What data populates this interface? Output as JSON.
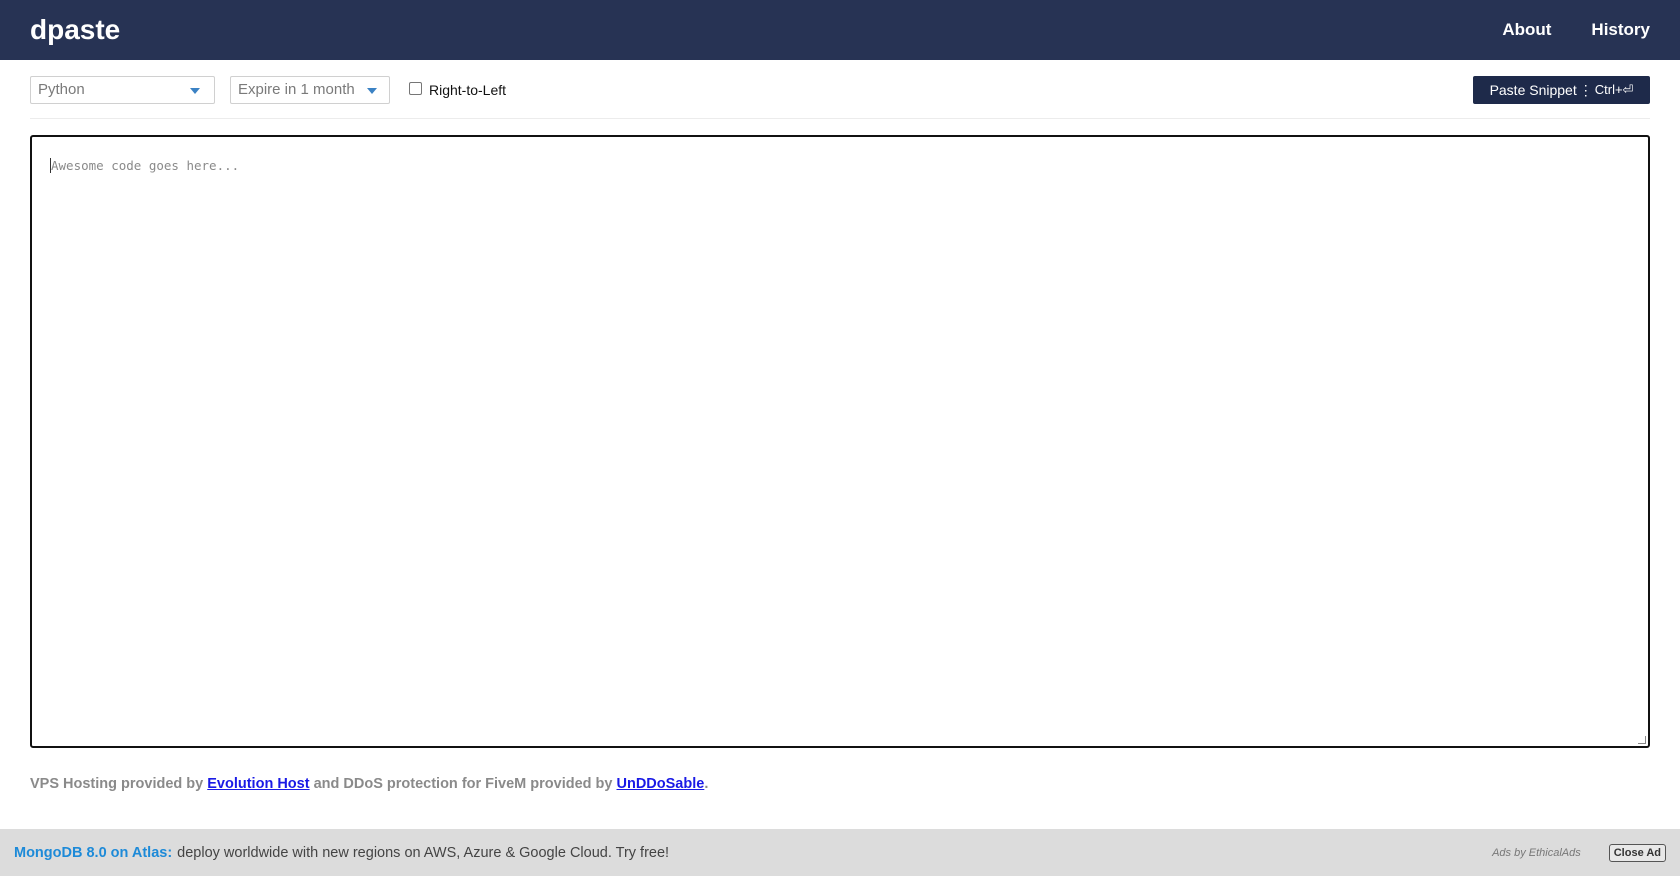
{
  "header": {
    "brand": "dpaste",
    "nav": [
      {
        "label": "About"
      },
      {
        "label": "History"
      }
    ]
  },
  "options": {
    "lexer": {
      "selected": "Python",
      "icon": "chevron-down-icon"
    },
    "expiry": {
      "selected": "Expire in 1 month",
      "icon": "chevron-down-icon"
    },
    "rtl_label": "Right-to-Left",
    "rtl_checked": false,
    "paste_button": {
      "label": "Paste Snippet",
      "shortcut": "Ctrl+⏎",
      "separator": "⋮"
    }
  },
  "editor": {
    "placeholder": "Awesome code goes here...",
    "value": ""
  },
  "footer": {
    "prefix": "VPS Hosting provided by ",
    "link1": "Evolution Host",
    "middle": " and DDoS protection for FiveM provided by ",
    "link2": "UnDDoSable",
    "suffix": "."
  },
  "ad": {
    "headline": "MongoDB 8.0 on Atlas:",
    "body": "deploy worldwide with new regions on AWS, Azure & Google Cloud. Try free!",
    "ads_by": "Ads by EthicalAds",
    "close_label": "Close Ad"
  },
  "colors": {
    "header_bg": "#273354",
    "button_bg": "#1e2a4a",
    "link": "#1a1ae6",
    "ad_accent": "#1d8ad8",
    "ad_bg": "#dcdcdc"
  }
}
